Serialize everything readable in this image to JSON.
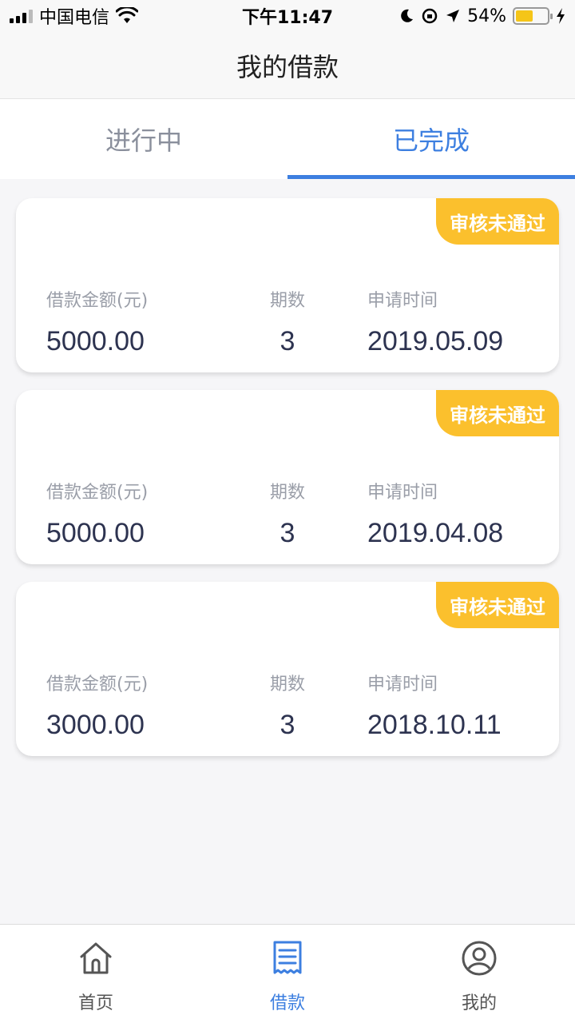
{
  "status_bar": {
    "carrier": "中国电信",
    "time": "下午11:47",
    "battery": "54%"
  },
  "nav": {
    "title": "我的借款"
  },
  "tabs": [
    {
      "label": "进行中",
      "active": false
    },
    {
      "label": "已完成",
      "active": true
    }
  ],
  "card_labels": {
    "amount": "借款金额(元)",
    "term": "期数",
    "date": "申请时间"
  },
  "loans": [
    {
      "status": "审核未通过",
      "amount": "5000.00",
      "term": "3",
      "date": "2019.05.09"
    },
    {
      "status": "审核未通过",
      "amount": "5000.00",
      "term": "3",
      "date": "2019.04.08"
    },
    {
      "status": "审核未通过",
      "amount": "3000.00",
      "term": "3",
      "date": "2018.10.11"
    }
  ],
  "tabbar": [
    {
      "label": "首页",
      "icon": "home-icon",
      "active": false
    },
    {
      "label": "借款",
      "icon": "receipt-icon",
      "active": true
    },
    {
      "label": "我的",
      "icon": "user-icon",
      "active": false
    }
  ],
  "colors": {
    "accent": "#3d7fe0",
    "badge": "#fbc02d"
  }
}
